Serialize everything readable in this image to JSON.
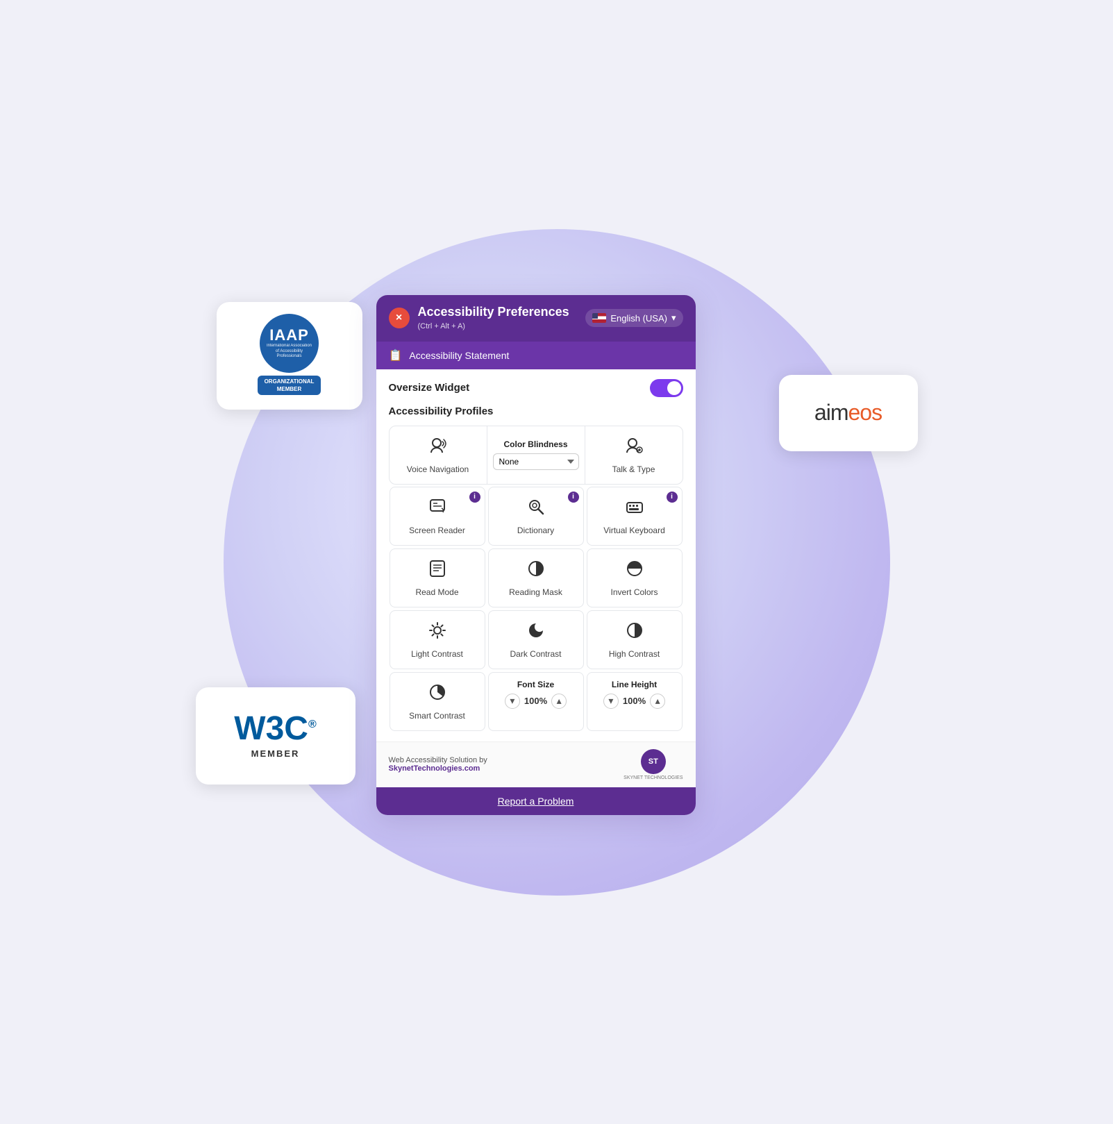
{
  "header": {
    "title": "Accessibility Preferences",
    "shortcut": "(Ctrl + Alt + A)",
    "close_label": "×",
    "lang_label": "English (USA)"
  },
  "statement_bar": {
    "label": "Accessibility Statement"
  },
  "oversize_widget": {
    "label": "Oversize Widget",
    "toggle_on": true
  },
  "profiles_section": {
    "label": "Accessibility Profiles"
  },
  "profiles_top": {
    "voice_nav": "Voice Navigation",
    "color_blindness": "Color Blindness",
    "color_blindness_default": "None",
    "talk_type": "Talk & Type"
  },
  "features": [
    {
      "label": "Screen Reader",
      "icon": "🖥",
      "has_info": true
    },
    {
      "label": "Dictionary",
      "icon": "🔍",
      "has_info": true
    },
    {
      "label": "Virtual Keyboard",
      "icon": "⌨",
      "has_info": true
    },
    {
      "label": "Read Mode",
      "icon": "📄",
      "has_info": false
    },
    {
      "label": "Reading Mask",
      "icon": "◑",
      "has_info": false
    },
    {
      "label": "Invert Colors",
      "icon": "◐",
      "has_info": false
    },
    {
      "label": "Light Contrast",
      "icon": "✳",
      "has_info": false
    },
    {
      "label": "Dark Contrast",
      "icon": "🌙",
      "has_info": false
    },
    {
      "label": "High Contrast",
      "icon": "◑",
      "has_info": false
    },
    {
      "label": "Smart Contrast",
      "icon": "◕",
      "has_info": false
    }
  ],
  "steppers": [
    {
      "label": "Font Size",
      "value": "100%",
      "has_down": true,
      "has_up": true
    },
    {
      "label": "Line Height",
      "value": "100%",
      "has_down": true,
      "has_up": true
    }
  ],
  "footer": {
    "text_line1": "Web Accessibility Solution by",
    "text_line2": "SkynetTechnologies.com",
    "logo_label": "ST",
    "logo_sub": "SKYNET TECHNOLOGIES"
  },
  "report_btn": "Report a Problem",
  "iaap": {
    "main": "IAAP",
    "sub": "International Association\nof Accessibility Professionals",
    "badge1": "ORGANIZATIONAL",
    "badge2": "MEMBER"
  },
  "w3c": {
    "main": "W3C",
    "member": "MEMBER"
  },
  "aimeos": {
    "aim": "aim",
    "eos": "eos"
  }
}
